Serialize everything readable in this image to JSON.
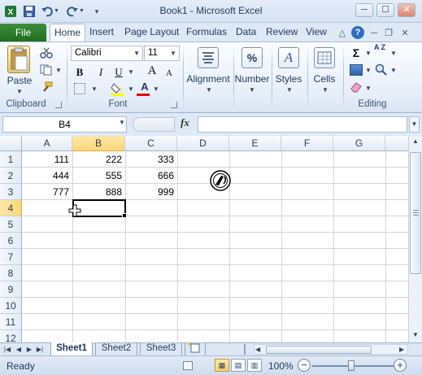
{
  "window": {
    "title": "Book1  -  Microsoft Excel",
    "controls": {
      "minimize": "─",
      "maximize": "☐",
      "close": "✕"
    }
  },
  "quick_access": {
    "app_icon": "excel-icon",
    "save_icon": "save-icon",
    "undo_icon": "undo-icon",
    "redo_icon": "redo-icon",
    "customize_icon": "customize-icon"
  },
  "ribbon_tabs": {
    "file": "File",
    "items": [
      "Home",
      "Insert",
      "Page Layout",
      "Formulas",
      "Data",
      "Review",
      "View"
    ]
  },
  "ribbon": {
    "clipboard": {
      "paste_label": "Paste",
      "group_label": "Clipboard"
    },
    "font": {
      "font_name": "Calibri",
      "font_size": "11",
      "bold": "B",
      "italic": "I",
      "underline": "U",
      "grow": "A",
      "shrink": "A",
      "font_color_glyph": "A",
      "group_label": "Font"
    },
    "alignment": {
      "label": "Alignment"
    },
    "number": {
      "label": "Number",
      "glyph": "%"
    },
    "styles": {
      "label": "Styles",
      "glyph": "A"
    },
    "cells": {
      "label": "Cells"
    },
    "editing": {
      "sum_glyph": "Σ",
      "sort_glyph": "A Z",
      "group_label": "Editing"
    }
  },
  "formula_bar": {
    "name_box": "B4",
    "fx": "fx",
    "formula": ""
  },
  "grid": {
    "columns": [
      "A",
      "B",
      "C",
      "D",
      "E",
      "F",
      "G"
    ],
    "rows": [
      "1",
      "2",
      "3",
      "4",
      "5",
      "6",
      "7",
      "8",
      "9",
      "10",
      "11",
      "12"
    ],
    "active_column": "B",
    "active_row": "4",
    "cells": {
      "A1": "111",
      "B1": "222",
      "C1": "333",
      "A2": "444",
      "B2": "555",
      "C2": "666",
      "A3": "777",
      "B3": "888",
      "C3": "999"
    }
  },
  "sheets": {
    "tabs": [
      "Sheet1",
      "Sheet2",
      "Sheet3"
    ],
    "active": "Sheet1"
  },
  "status": {
    "ready": "Ready",
    "zoom": "100%",
    "zoom_fraction": 0.5
  },
  "colors": {
    "file_tab": "#2a7a2a",
    "active_header": "#f9d77c",
    "ribbon_bg": "#e6eef8"
  }
}
